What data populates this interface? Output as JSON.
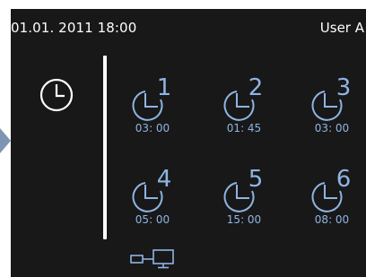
{
  "status": {
    "datetime": "01.01. 2011 18:00",
    "user": "User A"
  },
  "main_clock": {
    "icon": "clock-icon"
  },
  "timers": [
    {
      "number": "1",
      "time": "03: 00"
    },
    {
      "number": "2",
      "time": "01: 45"
    },
    {
      "number": "3",
      "time": "03: 00"
    },
    {
      "number": "4",
      "time": "05: 00"
    },
    {
      "number": "5",
      "time": "15: 00"
    },
    {
      "number": "6",
      "time": "08: 00"
    }
  ],
  "bottom": {
    "icon": "network-icon"
  },
  "colors": {
    "background": "#181818",
    "accent": "#8fb4e2",
    "text": "#ffffff",
    "arrow": "#7f95b4"
  }
}
